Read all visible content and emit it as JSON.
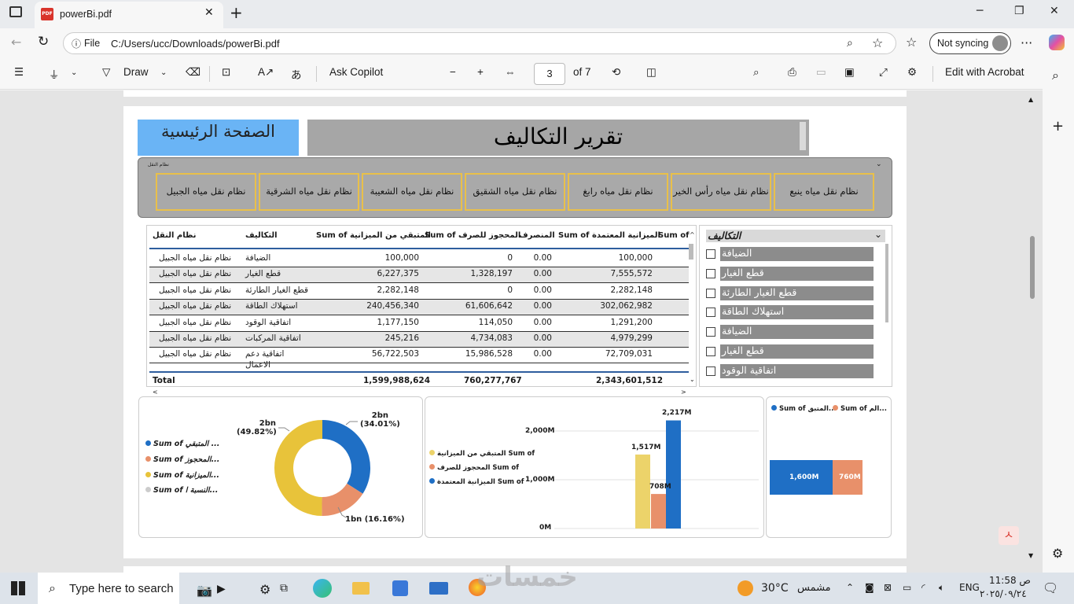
{
  "browser": {
    "tab_title": "powerBi.pdf",
    "file_label": "File",
    "url": "C:/Users/ucc/Downloads/powerBi.pdf",
    "sync_label": "Not syncing"
  },
  "pdf_toolbar": {
    "draw": "Draw",
    "ask_copilot": "Ask Copilot",
    "page": "3",
    "of": "of 7",
    "edit": "Edit with Acrobat"
  },
  "report": {
    "home_button": "الصفحة الرئيسية",
    "title": "تقرير التكاليف",
    "slicer_label": "نظام النقل",
    "systems": [
      "نظام نقل مياه ينبع",
      "نظام نقل مياه رأس الخير",
      "نظام نقل مياه رابغ",
      "نظام نقل مياه الشقيق",
      "نظام نقل مياه الشعيبة",
      "نظام نقل مياه الشرقية",
      "نظام نقل مياه الجبيل"
    ],
    "table": {
      "headers": [
        "نظام النقل",
        "التكاليف",
        "Sum of المتبقي من الميزانية",
        "Sum of المحجوز للصرف",
        "المنصرف",
        "Sum of الميزانية المعتمدة",
        "Sum of"
      ],
      "rows": [
        [
          "نظام نقل مياه الجبيل",
          "الضيافة",
          "100,000",
          "0",
          "0.00",
          "100,000"
        ],
        [
          "نظام نقل مياه الجبيل",
          "قطع الغيار",
          "6,227,375",
          "1,328,197",
          "0.00",
          "7,555,572"
        ],
        [
          "نظام نقل مياه الجبيل",
          "قطع الغيار الطارئة",
          "2,282,148",
          "0",
          "0.00",
          "2,282,148"
        ],
        [
          "نظام نقل مياه الجبيل",
          "استهلاك الطاقة",
          "240,456,340",
          "61,606,642",
          "0.00",
          "302,062,982"
        ],
        [
          "نظام نقل مياه الجبيل",
          "اتفاقية الوقود",
          "1,177,150",
          "114,050",
          "0.00",
          "1,291,200"
        ],
        [
          "نظام نقل مياه الجبيل",
          "اتفاقية المركبات",
          "245,216",
          "4,734,083",
          "0.00",
          "4,979,299"
        ],
        [
          "نظام نقل مياه الجبيل",
          "اتفاقية دعم",
          "56,722,503",
          "15,986,528",
          "0.00",
          "72,709,031"
        ]
      ],
      "row7_extra": "الاعمال",
      "total_label": "Total",
      "totals": [
        "1,599,988,624",
        "760,277,767",
        "2,343,601,512"
      ]
    },
    "costs_slicer": {
      "title": "التكاليف",
      "items": [
        "الضيافة",
        "قطع الغيار",
        "قطع الغيار الطارئة",
        "استهلاك الطاقة",
        "الضيافة",
        "قطع الغيار",
        "اتفاقية الوقود"
      ]
    },
    "donut": {
      "legend": [
        "Sum of المتبقي ...",
        "Sum of المحجوز...",
        "Sum of الميزانية...",
        "Sum of النسبة ا..."
      ],
      "labels": [
        {
          "v": "2bn",
          "p": "(34.01%)"
        },
        {
          "v": "1bn",
          "p": "(16.16%)"
        },
        {
          "v": "2bn",
          "p": "(49.82%)"
        }
      ]
    },
    "bar_chart": {
      "legend": [
        "المتبقي من الميزانية Sum of",
        "المحجوز للصرف Sum of",
        "الميزانية المعتمدة Sum of"
      ],
      "ticks": [
        "2,000M",
        "1,000M",
        "0M"
      ],
      "labels": [
        "1,517M",
        "708M",
        "2,217M"
      ]
    },
    "stacked": {
      "legend": [
        "Sum of المتبق...",
        "Sum of الم..."
      ],
      "labels": [
        "1,600M",
        "760M"
      ]
    }
  },
  "chart_data": [
    {
      "type": "pie",
      "title": "",
      "categories": [
        "Sum of المتبقي",
        "Sum of المحجوز",
        "Sum of الميزانية",
        "Sum of النسبة"
      ],
      "values": [
        34.01,
        16.16,
        49.82,
        0
      ],
      "colors": [
        "#1f6fc5",
        "#e8906a",
        "#e8c33a",
        "#cccccc"
      ]
    },
    {
      "type": "bar",
      "title": "",
      "categories": [
        ""
      ],
      "series": [
        {
          "name": "المتبقي من الميزانية Sum of",
          "values": [
            1517
          ]
        },
        {
          "name": "المحجوز للصرف Sum of",
          "values": [
            708
          ]
        },
        {
          "name": "الميزانية المعتمدة Sum of",
          "values": [
            2217
          ]
        }
      ],
      "ylim": [
        0,
        2300
      ],
      "colors": [
        "#ecd36a",
        "#e8906a",
        "#1f6fc5"
      ]
    },
    {
      "type": "bar",
      "title": "",
      "categories": [
        ""
      ],
      "series": [
        {
          "name": "Sum of المتبق...",
          "values": [
            1600
          ]
        },
        {
          "name": "Sum of الم...",
          "values": [
            760
          ]
        }
      ],
      "colors": [
        "#1f6fc5",
        "#e8906a"
      ]
    }
  ],
  "taskbar": {
    "search": "Type here to search",
    "temp": "30°C",
    "weather": "مشمس",
    "lang": "ENG",
    "time": "11:58 ص",
    "date": "٢٠٢٥/٠٩/٢٤",
    "watermark": "خمسات"
  },
  "colors": {
    "accent_blue": "#6ab4f5",
    "slicer_border": "#e9c04a",
    "gray": "#a9a9a9"
  }
}
